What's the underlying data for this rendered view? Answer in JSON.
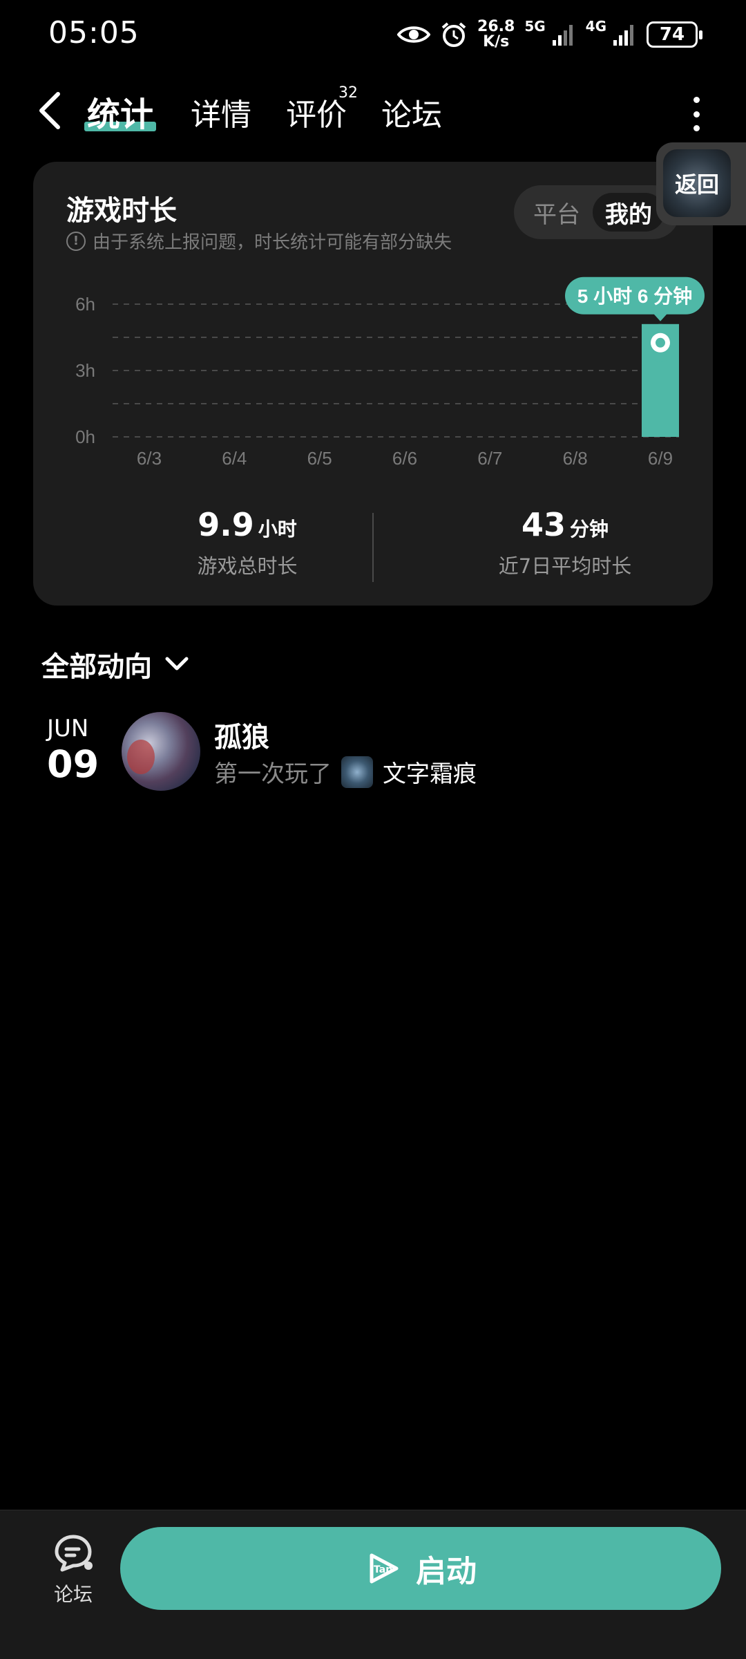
{
  "status_bar": {
    "time": "05:05",
    "net_speed_top": "26.8",
    "net_speed_bottom": "K/s",
    "sig1": "5G",
    "sig2": "4G",
    "battery": "74"
  },
  "nav": {
    "tabs": [
      {
        "label": "统计",
        "active": true
      },
      {
        "label": "详情"
      },
      {
        "label": "评价"
      },
      {
        "label": "论坛"
      }
    ],
    "review_badge": "32"
  },
  "stats_card": {
    "title": "游戏时长",
    "note": "由于系统上报问题，时长统计可能有部分缺失",
    "segments": {
      "platform": "平台",
      "mine": "我的"
    },
    "total": {
      "value": "9.9",
      "unit": "小时",
      "label": "游戏总时长"
    },
    "avg": {
      "value": "43",
      "unit": "分钟",
      "label": "近7日平均时长"
    }
  },
  "chart_data": {
    "type": "bar",
    "categories": [
      "6/3",
      "6/4",
      "6/5",
      "6/6",
      "6/7",
      "6/8",
      "6/9"
    ],
    "values": [
      0,
      0,
      0,
      0,
      0,
      0,
      5.1
    ],
    "ylim": [
      0,
      6
    ],
    "yticks": [
      "0h",
      "3h",
      "6h"
    ],
    "tooltip": "5 小时 6 分钟",
    "grid": true,
    "bar_color": "#4fb8a7"
  },
  "float_return": {
    "label": "返回"
  },
  "activity": {
    "title": "全部动向",
    "items": [
      {
        "month": "JUN",
        "day": "09",
        "user": "孤狼",
        "verb": "第一次玩了",
        "game": "文字霜痕"
      }
    ]
  },
  "bottom": {
    "forum_label": "论坛",
    "launch_label": "启动"
  },
  "colors": {
    "accent": "#4fb8a7",
    "card": "#1d1d1d"
  }
}
